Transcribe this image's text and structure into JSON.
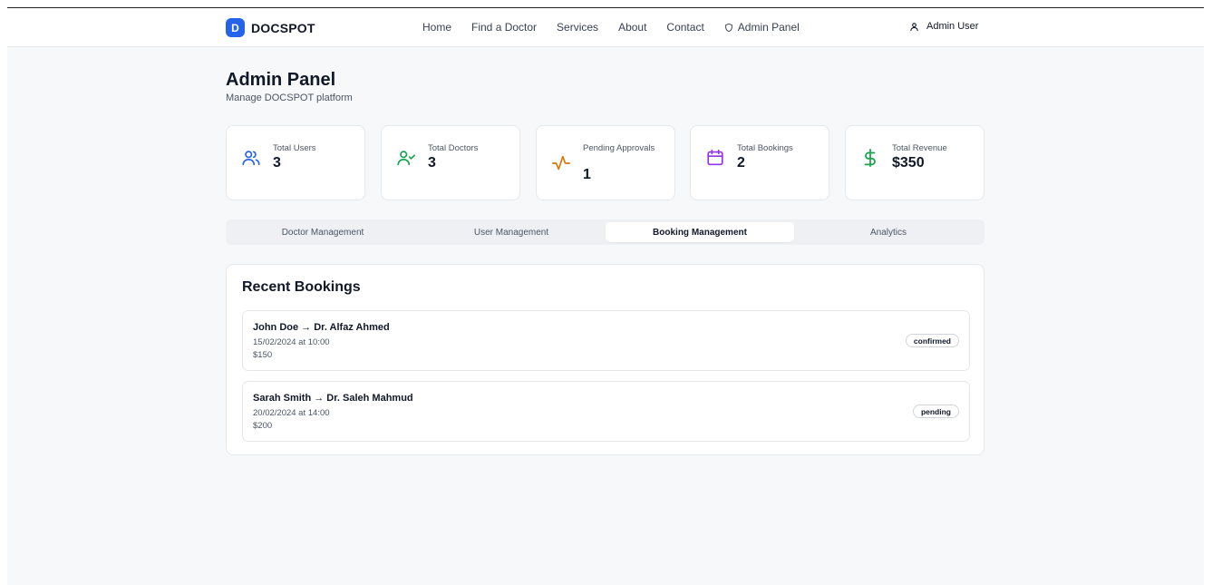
{
  "navbar": {
    "brand_letter": "D",
    "brand_name": "DOCSPOT",
    "links": [
      "Home",
      "Find a Doctor",
      "Services",
      "About",
      "Contact"
    ],
    "admin_link": "Admin Panel",
    "user_name": "Admin User"
  },
  "header": {
    "title": "Admin Panel",
    "subtitle": "Manage DOCSPOT platform"
  },
  "stats": [
    {
      "label": "Total Users",
      "value": "3",
      "icon": "users-icon",
      "color": "#2563eb"
    },
    {
      "label": "Total Doctors",
      "value": "3",
      "icon": "user-check-icon",
      "color": "#16a34a"
    },
    {
      "label": "Pending Approvals",
      "value": "1",
      "icon": "activity-icon",
      "color": "#d97706"
    },
    {
      "label": "Total Bookings",
      "value": "2",
      "icon": "calendar-icon",
      "color": "#9333ea"
    },
    {
      "label": "Total Revenue",
      "value": "$350",
      "icon": "dollar-icon",
      "color": "#16a34a"
    }
  ],
  "tabs": [
    {
      "label": "Doctor Management",
      "active": false
    },
    {
      "label": "User Management",
      "active": false
    },
    {
      "label": "Booking Management",
      "active": true
    },
    {
      "label": "Analytics",
      "active": false
    }
  ],
  "recent_bookings": {
    "title": "Recent Bookings",
    "items": [
      {
        "title": "John Doe → Dr. Alfaz Ahmed",
        "datetime": "15/02/2024 at 10:00",
        "price": "$150",
        "status": "confirmed"
      },
      {
        "title": "Sarah Smith → Dr. Saleh Mahmud",
        "datetime": "20/02/2024 at 14:00",
        "price": "$200",
        "status": "pending"
      }
    ]
  }
}
